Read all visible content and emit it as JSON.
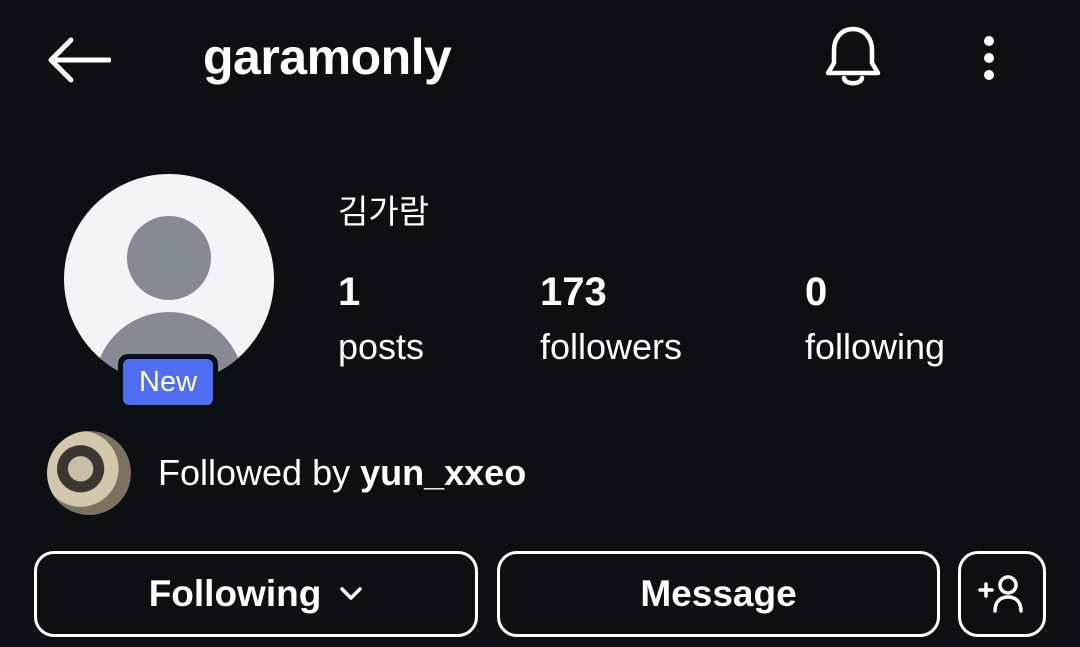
{
  "header": {
    "username": "garamonly",
    "back_icon": "arrow-left-icon",
    "notifications_icon": "bell-icon",
    "more_icon": "more-vertical-icon"
  },
  "profile": {
    "display_name": "김가람",
    "new_badge": "New",
    "stats": [
      {
        "value": "1",
        "label": "posts"
      },
      {
        "value": "173",
        "label": "followers"
      },
      {
        "value": "0",
        "label": "following"
      }
    ]
  },
  "followed_by": {
    "prefix": "Followed by ",
    "username": "yun_xxeo"
  },
  "actions": {
    "following_label": "Following",
    "message_label": "Message",
    "add_user_icon": "add-person-icon"
  },
  "colors": {
    "background": "#0c0f14",
    "badge": "#4f6ef2"
  }
}
